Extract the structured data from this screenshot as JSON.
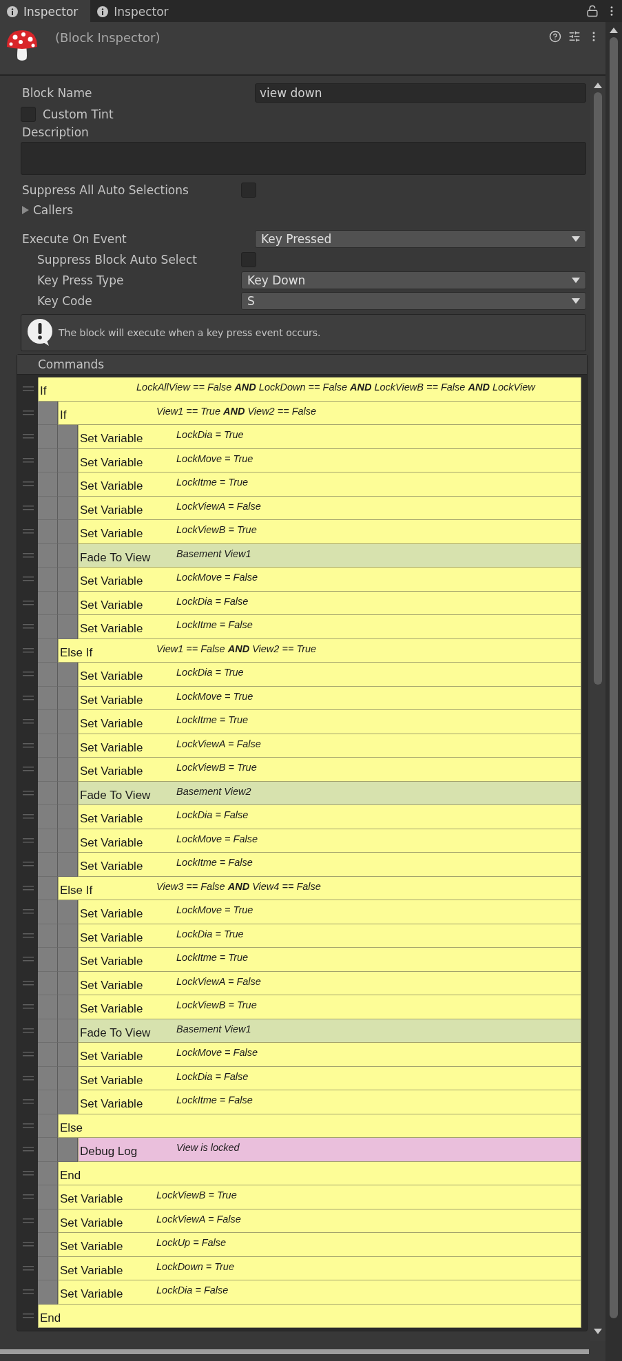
{
  "tabs": [
    {
      "label": "Inspector",
      "selected": true
    },
    {
      "label": "Inspector",
      "selected": false
    }
  ],
  "header": {
    "title": "(Block Inspector)"
  },
  "block_name": {
    "label": "Block Name",
    "value": "view down"
  },
  "custom_tint": {
    "label": "Custom Tint",
    "checked": false
  },
  "description": {
    "label": "Description"
  },
  "suppress_all": {
    "label": "Suppress All Auto Selections",
    "checked": false
  },
  "callers": {
    "label": "Callers",
    "expanded": false
  },
  "execute_on_event": {
    "label": "Execute On Event",
    "value": "Key Pressed"
  },
  "event_settings": [
    {
      "kind": "checkbox",
      "label": "Suppress Block Auto Select",
      "checked": false
    },
    {
      "kind": "dropdown",
      "label": "Key Press Type",
      "value": "Key Down"
    },
    {
      "kind": "dropdown",
      "label": "Key Code",
      "value": "S"
    }
  ],
  "help": {
    "text": "The block will execute when a key press event occurs."
  },
  "commands": {
    "title": "Commands",
    "items": [
      {
        "name": "If",
        "summary": "LockAllView == False **AND** LockDown == False **AND** LockViewB == False **AND** LockView",
        "color": "#fdfd97",
        "children": [
          {
            "name": "If",
            "summary": "View1 == True **AND** View2 == False",
            "color": "#fdfd97",
            "children": [
              {
                "name": "Set Variable",
                "summary": "LockDia = True",
                "color": "#fdfd97"
              },
              {
                "name": "Set Variable",
                "summary": "LockMove = True",
                "color": "#fdfd97"
              },
              {
                "name": "Set Variable",
                "summary": "LockItme = True",
                "color": "#fdfd97"
              },
              {
                "name": "Set Variable",
                "summary": "LockViewA = False",
                "color": "#fdfd97"
              },
              {
                "name": "Set Variable",
                "summary": "LockViewB = True",
                "color": "#fdfd97"
              },
              {
                "name": "Fade To View",
                "summary": "Basement View1",
                "color": "#d7e2ae"
              },
              {
                "name": "Set Variable",
                "summary": "LockMove = False",
                "color": "#fdfd97"
              },
              {
                "name": "Set Variable",
                "summary": "LockDia = False",
                "color": "#fdfd97"
              },
              {
                "name": "Set Variable",
                "summary": "LockItme = False",
                "color": "#fdfd97"
              }
            ]
          },
          {
            "name": "Else If",
            "summary": "View1 == False **AND** View2 == True",
            "color": "#fdfd97",
            "children": [
              {
                "name": "Set Variable",
                "summary": "LockDia = True",
                "color": "#fdfd97"
              },
              {
                "name": "Set Variable",
                "summary": "LockMove = True",
                "color": "#fdfd97"
              },
              {
                "name": "Set Variable",
                "summary": "LockItme = True",
                "color": "#fdfd97"
              },
              {
                "name": "Set Variable",
                "summary": "LockViewA = False",
                "color": "#fdfd97"
              },
              {
                "name": "Set Variable",
                "summary": "LockViewB = True",
                "color": "#fdfd97"
              },
              {
                "name": "Fade To View",
                "summary": "Basement View2",
                "color": "#d7e2ae"
              },
              {
                "name": "Set Variable",
                "summary": "LockDia = False",
                "color": "#fdfd97"
              },
              {
                "name": "Set Variable",
                "summary": "LockMove = False",
                "color": "#fdfd97"
              },
              {
                "name": "Set Variable",
                "summary": "LockItme = False",
                "color": "#fdfd97"
              }
            ]
          },
          {
            "name": "Else If",
            "summary": "View3 == False **AND** View4 == False",
            "color": "#fdfd97",
            "children": [
              {
                "name": "Set Variable",
                "summary": "LockMove = True",
                "color": "#fdfd97"
              },
              {
                "name": "Set Variable",
                "summary": "LockDia = True",
                "color": "#fdfd97"
              },
              {
                "name": "Set Variable",
                "summary": "LockItme = True",
                "color": "#fdfd97"
              },
              {
                "name": "Set Variable",
                "summary": "LockViewA = False",
                "color": "#fdfd97"
              },
              {
                "name": "Set Variable",
                "summary": "LockViewB = True",
                "color": "#fdfd97"
              },
              {
                "name": "Fade To View",
                "summary": "Basement View1",
                "color": "#d7e2ae"
              },
              {
                "name": "Set Variable",
                "summary": "LockMove = False",
                "color": "#fdfd97"
              },
              {
                "name": "Set Variable",
                "summary": "LockDia = False",
                "color": "#fdfd97"
              },
              {
                "name": "Set Variable",
                "summary": "LockItme = False",
                "color": "#fdfd97"
              }
            ]
          },
          {
            "name": "Else",
            "color": "#fdfd97",
            "children": [
              {
                "name": "Debug Log",
                "summary": "View is locked",
                "color": "#eabfdc"
              }
            ]
          },
          {
            "name": "End",
            "color": "#fdfd97"
          },
          {
            "name": "Set Variable",
            "summary": "LockViewB = True",
            "color": "#fdfd97"
          },
          {
            "name": "Set Variable",
            "summary": "LockViewA = False",
            "color": "#fdfd97"
          },
          {
            "name": "Set Variable",
            "summary": "LockUp = False",
            "color": "#fdfd97"
          },
          {
            "name": "Set Variable",
            "summary": "LockDown = True",
            "color": "#fdfd97"
          },
          {
            "name": "Set Variable",
            "summary": "LockDia = False",
            "color": "#fdfd97"
          }
        ]
      },
      {
        "name": "End",
        "color": "#fdfd97"
      }
    ]
  }
}
